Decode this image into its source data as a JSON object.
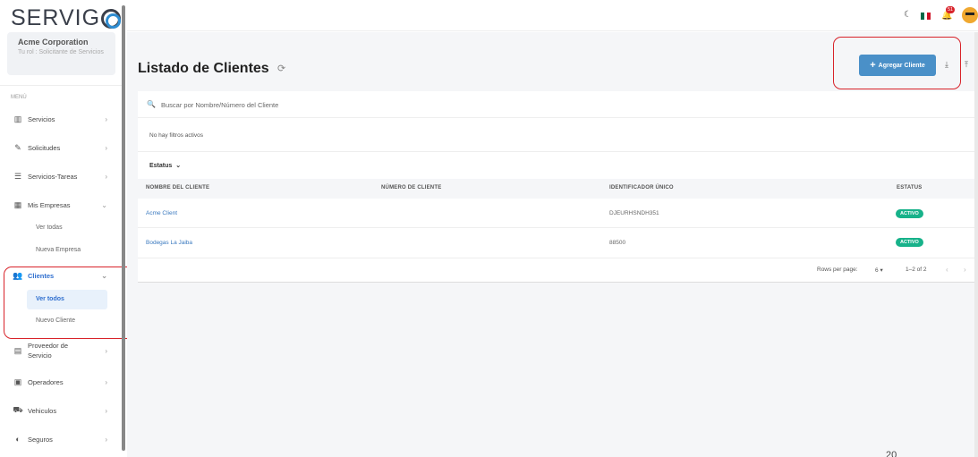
{
  "brand": {
    "logo_text": "SERVI",
    "logo_g": "G"
  },
  "org": {
    "name": "Acme Corporation",
    "role": "Tu rol : Solicitante de Servicios"
  },
  "menu_title": "MENÚ",
  "sidebar": {
    "items": [
      {
        "label": "Servicios",
        "icon": "servicios-icon"
      },
      {
        "label": "Solicitudes",
        "icon": "solicitudes-icon"
      },
      {
        "label": "Servicios-Tareas",
        "icon": "tareas-icon"
      },
      {
        "label": "Mis Empresas",
        "icon": "building-icon"
      },
      {
        "label": "Clientes",
        "icon": "users-icon"
      },
      {
        "label": "Proveedor de Servicio",
        "icon": "id-card-icon"
      },
      {
        "label": "Operadores",
        "icon": "operator-icon"
      },
      {
        "label": "Vehiculos",
        "icon": "truck-icon"
      },
      {
        "label": "Seguros",
        "icon": "shield-icon"
      }
    ],
    "empresas_sub": [
      "Ver todas",
      "Nueva Empresa"
    ],
    "clientes_sub": [
      "Ver todos",
      "Nuevo Cliente"
    ]
  },
  "topbar": {
    "notifications": "51"
  },
  "main": {
    "title": "Listado de Clientes",
    "add_button": "Agregar Cliente",
    "search_placeholder": "Buscar por Nombre/Número del Cliente",
    "no_filters": "No hay filtros activos",
    "status_filter": "Estatus",
    "columns": [
      "NOMBRE DEL CLIENTE",
      "NÚMERO DE CLIENTE",
      "IDENTIFICADOR ÚNICO",
      "ESTATUS"
    ],
    "rows": [
      {
        "name": "Acme Client",
        "number": "",
        "uid": "DJEURHSNDH351",
        "status": "ACTIVO"
      },
      {
        "name": "Bodegas La Jaiba",
        "number": "",
        "uid": "88500",
        "status": "ACTIVO"
      }
    ],
    "pager": {
      "rows_label": "Rows per page:",
      "rows_value": "6",
      "range": "1–2 of 2"
    }
  },
  "page_number": "20",
  "colors": {
    "accent": "#2f6fcf",
    "button": "#4a90c8",
    "badge": "#17b28a",
    "highlight": "#d8232a"
  }
}
